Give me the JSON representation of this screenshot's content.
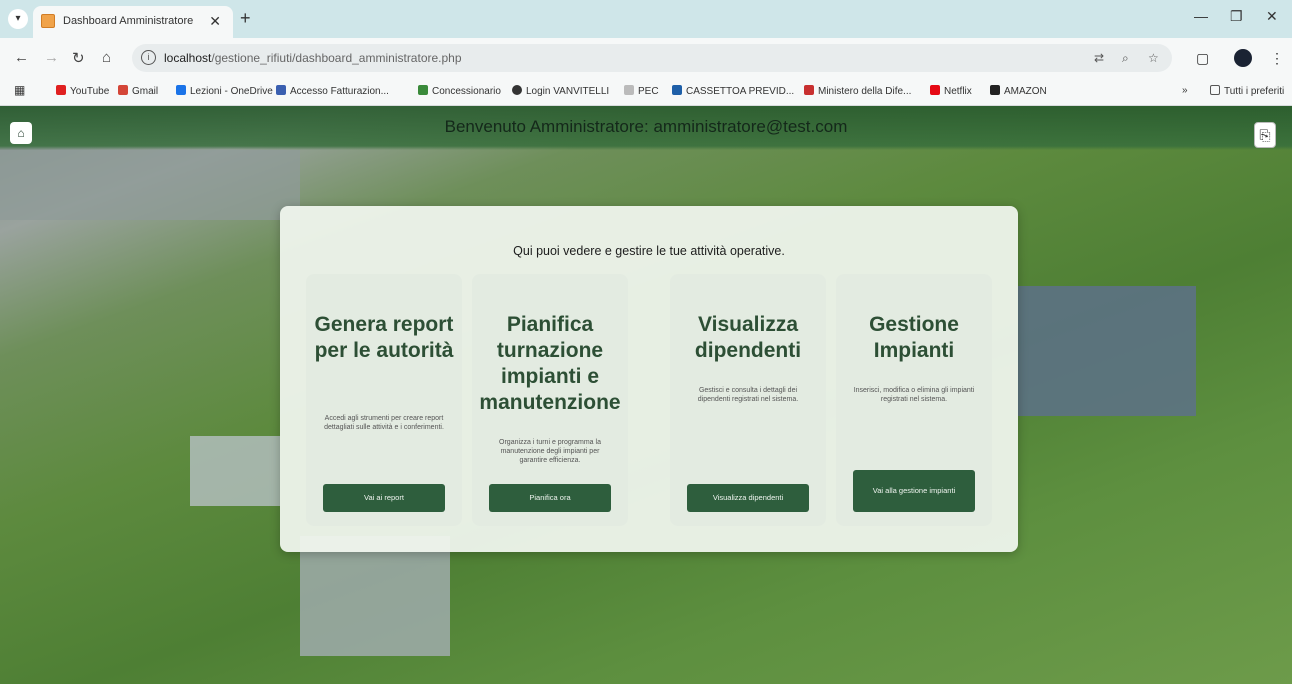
{
  "browser": {
    "tab_title": "Dashboard Amministratore",
    "url_host": "localhost",
    "url_path": "/gestione_rifiuti/dashboard_amministratore.php",
    "all_bookmarks": "Tutti i preferiti",
    "bookmarks": [
      "YouTube",
      "Gmail",
      "Lezioni - OneDrive",
      "Accesso Fatturazion...",
      "Concessionario",
      "Login VANVITELLI",
      "PEC",
      "CASSETTOA PREVID...",
      "Ministero della Dife...",
      "Netflix",
      "AMAZON"
    ]
  },
  "header": {
    "welcome": "Benvenuto Amministratore: amministratore@test.com"
  },
  "panel": {
    "subtitle": "Qui puoi vedere e gestire le tue attività operative."
  },
  "cards": [
    {
      "title": "Genera report per le autorità",
      "description": "Accedi agli strumenti per creare report dettagliati sulle attività e i conferimenti.",
      "button": "Vai ai report"
    },
    {
      "title": "Pianifica turnazione impianti e manutenzione",
      "description": "Organizza i turni e programma la manutenzione degli impianti per garantire efficienza.",
      "button": "Pianifica ora"
    },
    {
      "title": "Visualizza dipendenti",
      "description": "Gestisci e consulta i dettagli dei dipendenti registrati nel sistema.",
      "button": "Visualizza dipendenti"
    },
    {
      "title": "Gestione Impianti",
      "description": "Inserisci, modifica o elimina gli impianti registrati nel sistema.",
      "button": "Vai alla gestione impianti"
    }
  ]
}
